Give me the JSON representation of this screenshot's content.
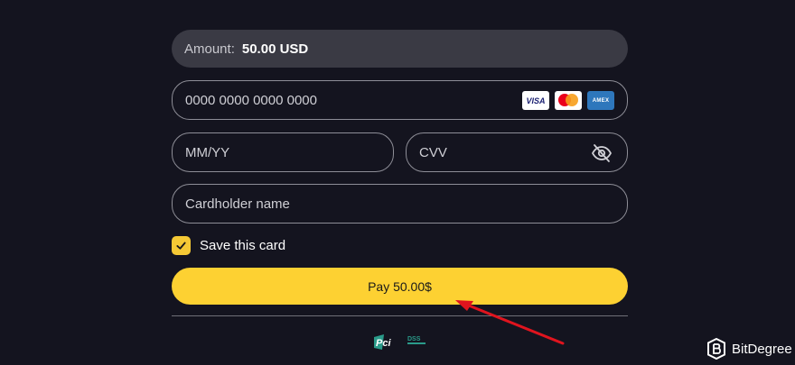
{
  "amount": {
    "label": "Amount:",
    "value": "50.00 USD"
  },
  "card_number": {
    "placeholder": "0000 0000 0000 0000"
  },
  "card_logos": {
    "visa": "VISA",
    "amex": "AMEX"
  },
  "expiry": {
    "placeholder": "MM/YY"
  },
  "cvv": {
    "placeholder": "CVV"
  },
  "cardholder": {
    "placeholder": "Cardholder name"
  },
  "save_card": {
    "label": "Save this card",
    "checked": true
  },
  "pay_button": {
    "label": "Pay 50.00$"
  },
  "pci": {
    "text": "Pci",
    "sub": "DSS"
  },
  "watermark": {
    "text": "BitDegree"
  },
  "colors": {
    "accent": "#fdd132",
    "background": "#14141f",
    "arrow": "#e0141e"
  },
  "icons": {
    "hide_password": "eye-off-icon",
    "check": "check-icon"
  }
}
